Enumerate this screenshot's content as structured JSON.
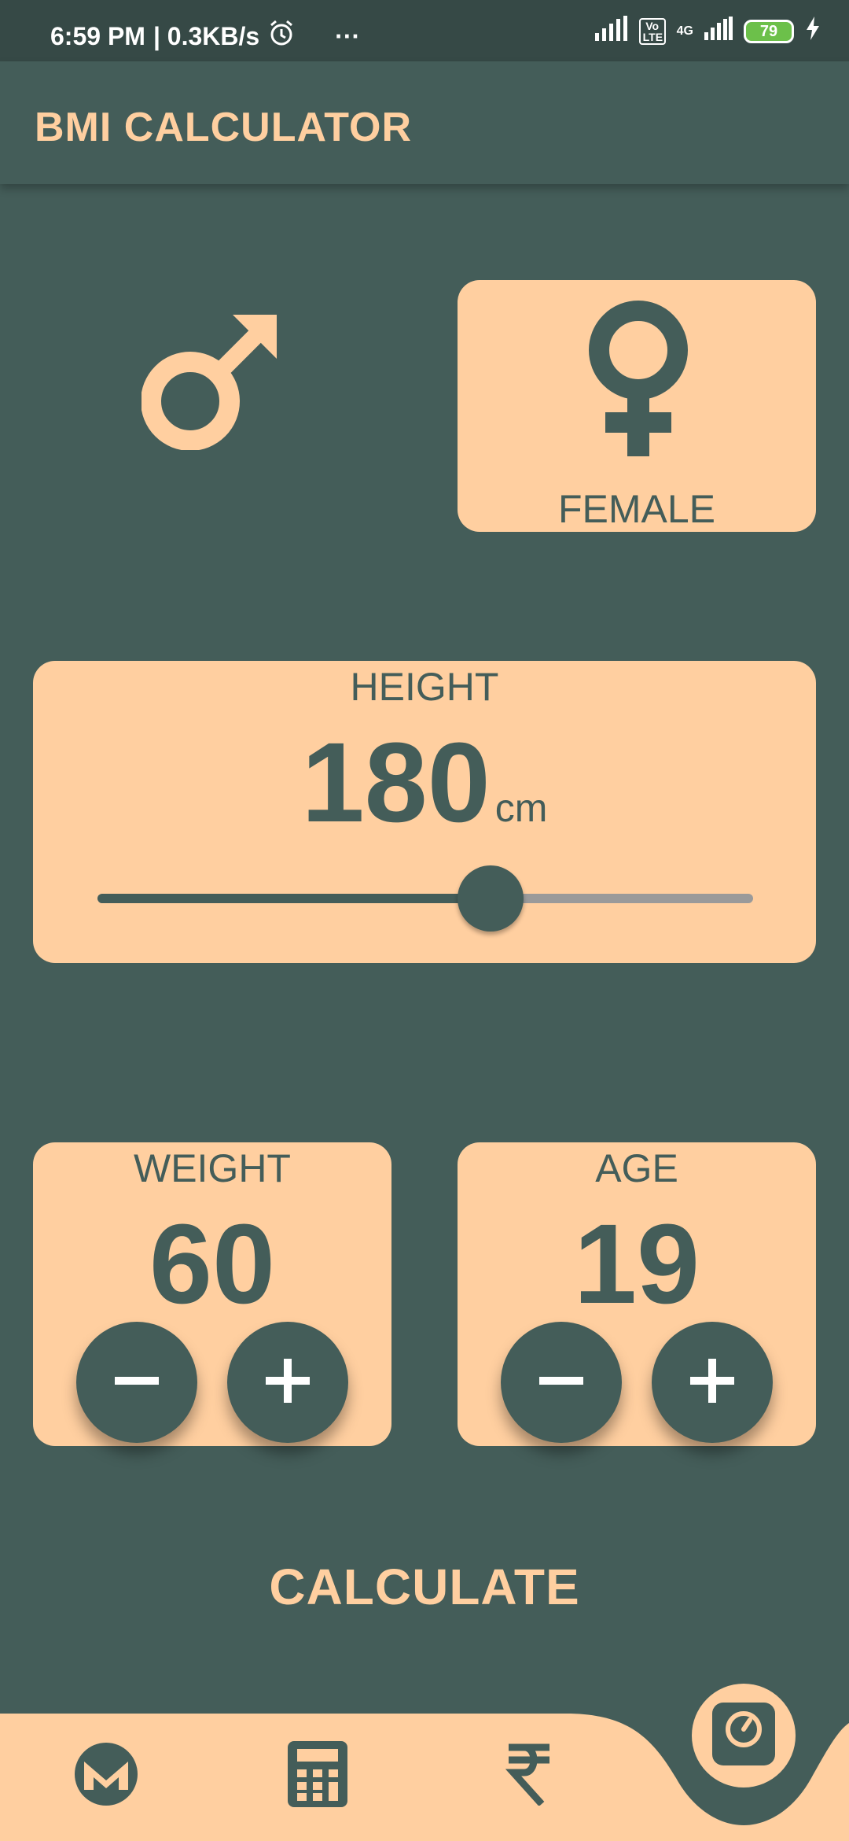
{
  "status_bar": {
    "time": "6:59 PM",
    "speed": "| 0.3KB/s",
    "more": "···",
    "network_label": "4G",
    "volte": "Vo LTE",
    "battery": "79"
  },
  "app_bar": {
    "title": "BMI CALCULATOR"
  },
  "gender": {
    "male": {
      "icon": "male-icon"
    },
    "female": {
      "label": "FEMALE",
      "icon": "female-icon",
      "selected": true
    }
  },
  "height": {
    "label": "HEIGHT",
    "value": "180",
    "unit": "cm",
    "fraction": 0.6
  },
  "weight": {
    "label": "WEIGHT",
    "value": "60",
    "minus": "−",
    "plus": "+"
  },
  "age": {
    "label": "AGE",
    "value": "19",
    "minus": "−",
    "plus": "+"
  },
  "calculate": {
    "label": "CALCULATE"
  },
  "bottom_nav": {
    "items": [
      {
        "icon": "monero-icon"
      },
      {
        "icon": "calculator-icon"
      },
      {
        "icon": "rupee-icon"
      },
      {
        "icon": "scale-icon",
        "active": true
      }
    ]
  },
  "colors": {
    "background": "#445d59",
    "card": "#ffcfa0",
    "accent_text": "#ffcfa0"
  }
}
